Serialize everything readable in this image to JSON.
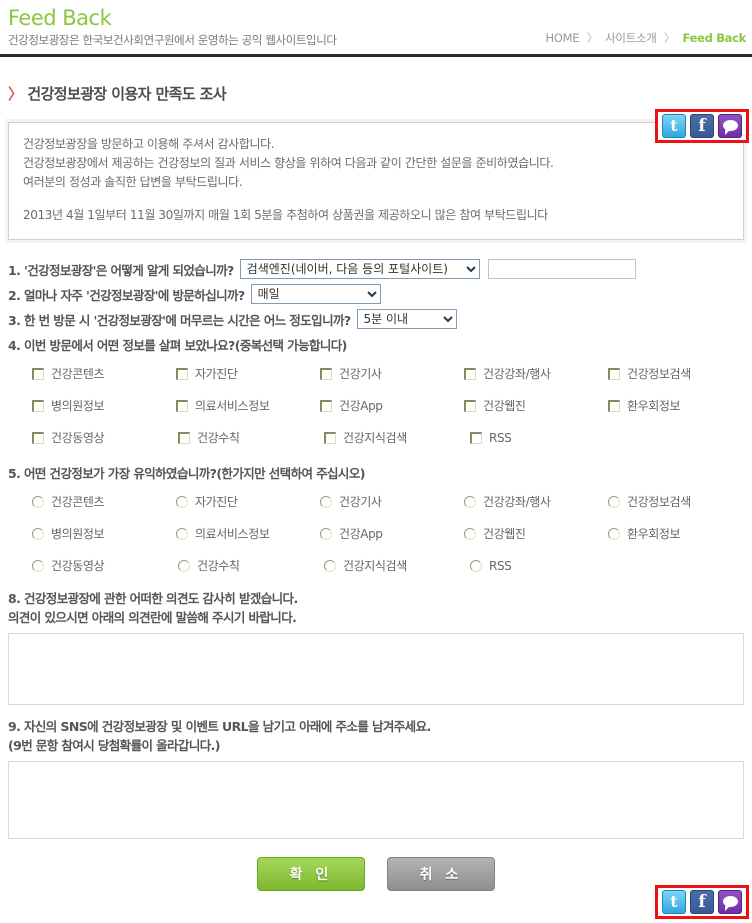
{
  "header": {
    "site_title": "Feed Back",
    "site_subtitle": "건강정보광장은 한국보건사회연구원에서 운영하는 공익 웹사이트입니다",
    "breadcrumb": {
      "home": "HOME",
      "sep": "〉",
      "section": "사이트소개",
      "current": "Feed Back"
    }
  },
  "page_title": {
    "chevron": "〉",
    "text": "건강정보광장 이용자 만족도 조사"
  },
  "social": {
    "twitter_glyph": "t",
    "facebook_glyph": "f",
    "me2day_name": "me2day-icon"
  },
  "notice": {
    "line1": "건강정보광장을 방문하고 이용해 주셔서 감사합니다.",
    "line2": "건강정보광장에서 제공하는 건강정보의 질과 서비스 향상을 위하여 다음과 같이 간단한 설문을 준비하였습니다.",
    "line3": "여러분의 정성과 솔직한 답변을 부탁드립니다.",
    "line4": "2013년 4월 1일부터 11월 30일까지 매월 1회 5분을 추첨하여 상품권을 제공하오니 많은 참여 부탁드립니다"
  },
  "questions": {
    "q1": {
      "label": "1. '건강정보광장'은 어떻게 알게 되었습니까?",
      "select_value": "검색엔진(네이버, 다음 등의 포털사이트)",
      "options": [
        "검색엔진(네이버, 다음 등의 포털사이트)"
      ],
      "text_value": "",
      "text_placeholder": ""
    },
    "q2": {
      "label": "2. 얼마나 자주 '건강정보광장'에 방문하십니까?",
      "select_value": "매일",
      "options": [
        "매일"
      ]
    },
    "q3": {
      "label": "3. 한 번 방문 시 '건강정보광장'에 머무르는 시간은 어느 정도입니까?",
      "select_value": "5분 이내",
      "options": [
        "5분 이내"
      ]
    },
    "q4": {
      "label": "4. 이번 방문에서 어떤 정보를 살펴 보았나요?",
      "hint": "(중복선택 가능합니다)",
      "options": [
        "건강콘텐츠",
        "자가진단",
        "건강기사",
        "건강강좌/행사",
        "건강정보검색",
        "병의원정보",
        "의료서비스정보",
        "건강App",
        "건강웹진",
        "환우회정보",
        "건강동영상",
        "건강수칙",
        "건강지식검색",
        "RSS"
      ]
    },
    "q5": {
      "label": "5. 어떤 건강정보가 가장 유익하였습니까?",
      "hint": "(한가지만 선택하여 주십시오)",
      "options": [
        "건강콘텐츠",
        "자가진단",
        "건강기사",
        "건강강좌/행사",
        "건강정보검색",
        "병의원정보",
        "의료서비스정보",
        "건강App",
        "건강웹진",
        "환우회정보",
        "건강동영상",
        "건강수칙",
        "건강지식검색",
        "RSS"
      ]
    },
    "q8": {
      "line1": "8. 건강정보광장에 관한 어떠한 의견도 감사히 받겠습니다.",
      "line2": "의견이 있으시면 아래의 의견란에 말씀해 주시기 바랍니다.",
      "value": "",
      "placeholder": ""
    },
    "q9": {
      "line1": "9. 자신의 SNS에 건강정보광장 및 이벤트 URL을 남기고 아래에 주소를 남겨주세요.",
      "line2": "(9번 문항 참여시 당첨확률이 올라갑니다.)",
      "value": "",
      "placeholder": ""
    }
  },
  "buttons": {
    "confirm": "확 인",
    "cancel": "취 소"
  },
  "colors": {
    "brand_green": "#8cc63e",
    "title_gray": "#4d4d4d",
    "chevron_red": "#e05a5a",
    "social_border_red": "#ee1111",
    "button_green": "#7cb82f",
    "button_gray": "#8f8f8f"
  }
}
